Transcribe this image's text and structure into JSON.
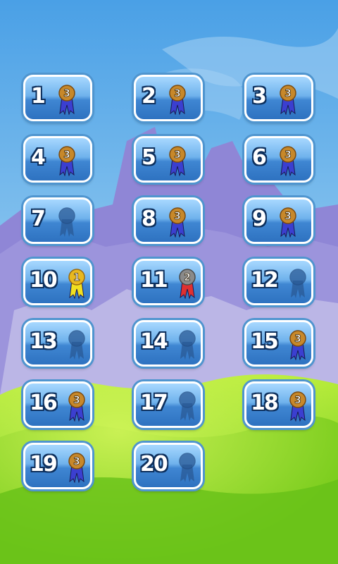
{
  "levels": [
    {
      "label": "1",
      "medal": "bronze-3-ribbon"
    },
    {
      "label": "2",
      "medal": "bronze-3-ribbon"
    },
    {
      "label": "3",
      "medal": "bronze-3-ribbon"
    },
    {
      "label": "4",
      "medal": "bronze-3-ribbon"
    },
    {
      "label": "5",
      "medal": "bronze-3-ribbon"
    },
    {
      "label": "6",
      "medal": "bronze-3-ribbon"
    },
    {
      "label": "7",
      "medal": "locked-silhouette"
    },
    {
      "label": "8",
      "medal": "bronze-3-ribbon"
    },
    {
      "label": "9",
      "medal": "bronze-3-ribbon"
    },
    {
      "label": "10",
      "medal": "gold-1-ribbon"
    },
    {
      "label": "11",
      "medal": "silver-2-ribbon"
    },
    {
      "label": "12",
      "medal": "locked-silhouette"
    },
    {
      "label": "13",
      "medal": "locked-silhouette"
    },
    {
      "label": "14",
      "medal": "locked-silhouette"
    },
    {
      "label": "15",
      "medal": "bronze-3-ribbon"
    },
    {
      "label": "16",
      "medal": "bronze-3-ribbon"
    },
    {
      "label": "17",
      "medal": "locked-silhouette"
    },
    {
      "label": "18",
      "medal": "bronze-3-ribbon"
    },
    {
      "label": "19",
      "medal": "bronze-3-ribbon"
    },
    {
      "label": "20",
      "medal": "locked-silhouette"
    }
  ],
  "medal_text": {
    "bronze": "3",
    "silver": "2",
    "gold": "1"
  },
  "colors": {
    "button_top": "#a7d8ff",
    "button_bottom": "#2e72c0",
    "button_outline": "#4f95cf",
    "number_outline": "#0d2f5c",
    "sky": "#5aaae6",
    "hills": "#7ccd1e",
    "bronze": "#c7882a",
    "silver": "#8a8a8a",
    "gold": "#e8b820",
    "ribbon_blue": "#3b3fd0",
    "ribbon_red": "#e03030",
    "ribbon_yellow": "#f2e020"
  }
}
